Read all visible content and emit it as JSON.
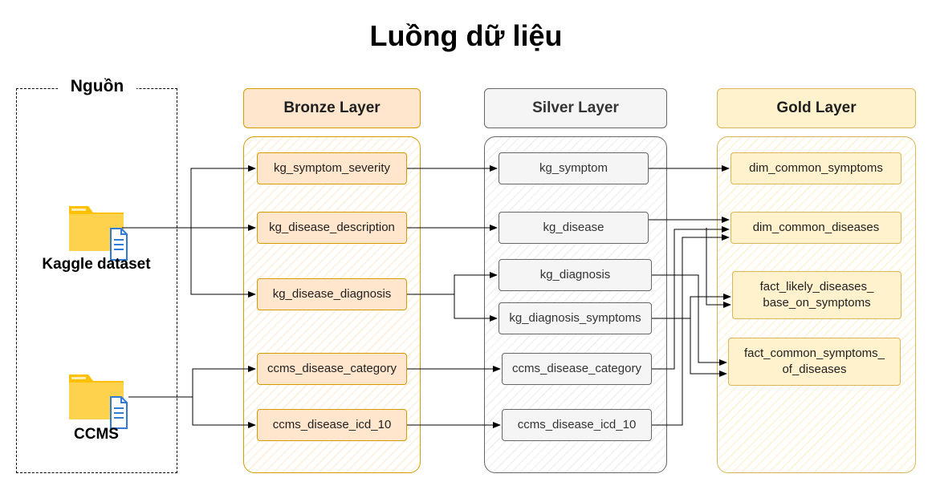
{
  "title": "Luồng dữ liệu",
  "source": {
    "title": "Nguồn",
    "items": [
      {
        "label": "Kaggle dataset",
        "icon": "folder-document-icon"
      },
      {
        "label": "CCMS",
        "icon": "folder-document-icon"
      }
    ]
  },
  "layers": {
    "bronze": {
      "title": "Bronze Layer",
      "nodes": [
        "kg_symptom_severity",
        "kg_disease_description",
        "kg_disease_diagnosis",
        "ccms_disease_category",
        "ccms_disease_icd_10"
      ]
    },
    "silver": {
      "title": "Silver Layer",
      "nodes": [
        "kg_symptom",
        "kg_disease",
        "kg_diagnosis",
        "kg_diagnosis_symptoms",
        "ccms_disease_category",
        "ccms_disease_icd_10"
      ]
    },
    "gold": {
      "title": "Gold Layer",
      "nodes": [
        "dim_common_symptoms",
        "dim_common_diseases",
        "fact_likely_diseases_\nbase_on_symptoms",
        "fact_common_symptoms_\nof_diseases"
      ]
    }
  },
  "colors": {
    "bronze_fill": "#ffe6cc",
    "bronze_stroke": "#d79b00",
    "silver_fill": "#f5f5f5",
    "silver_stroke": "#666666",
    "gold_fill": "#fff2cc",
    "gold_stroke": "#d6b656",
    "folder": "#ffc000",
    "document": "#2f7bd6"
  }
}
